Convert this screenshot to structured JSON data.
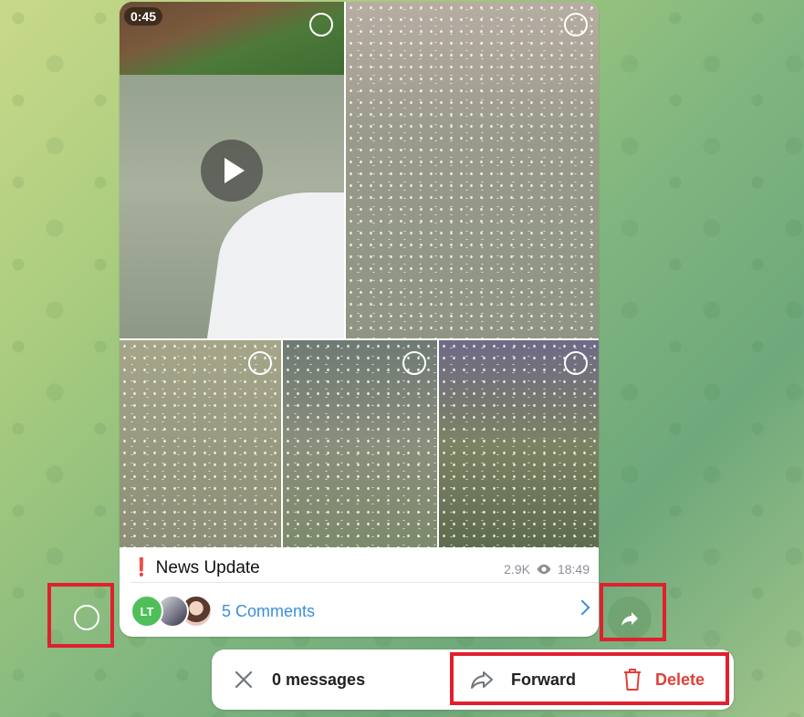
{
  "message": {
    "video_duration": "0:45",
    "caption_marker": "❗",
    "caption": "News Update",
    "views": "2.9K",
    "time": "18:49",
    "comments_label": "5 Comments",
    "avatars": [
      {
        "initials": "LT",
        "color": "#4fbf5a"
      },
      {
        "initials": "",
        "color": ""
      },
      {
        "initials": "",
        "color": ""
      }
    ]
  },
  "selection_bar": {
    "count_label": "0 messages",
    "forward_label": "Forward",
    "delete_label": "Delete"
  },
  "colors": {
    "accent": "#3a8fd9",
    "delete": "#e0403a",
    "highlight": "#e0202e"
  },
  "icons": [
    "play-icon",
    "eye-icon",
    "chevron-right-icon",
    "share-icon",
    "close-icon",
    "forward-icon",
    "trash-icon"
  ]
}
